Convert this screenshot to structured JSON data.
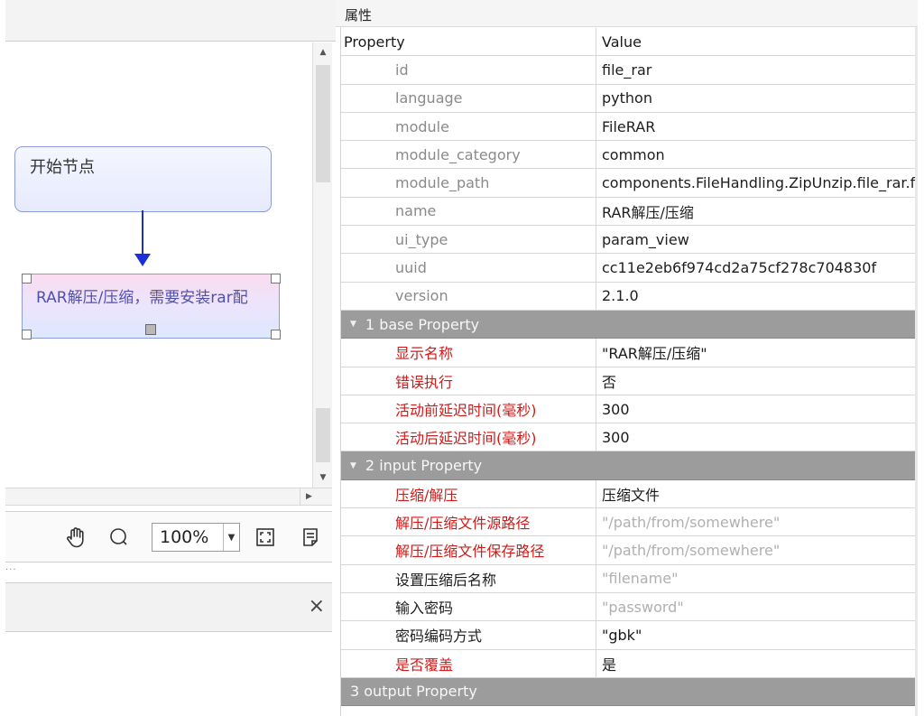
{
  "properties_panel": {
    "title": "属性",
    "header": {
      "property": "Property",
      "value": "Value"
    },
    "meta_rows": [
      {
        "key": "id",
        "value": "file_rar"
      },
      {
        "key": "language",
        "value": "python"
      },
      {
        "key": "module",
        "value": "FileRAR"
      },
      {
        "key": "module_category",
        "value": "common"
      },
      {
        "key": "module_path",
        "value": "components.FileHandling.ZipUnzip.file_rar.f"
      },
      {
        "key": "name",
        "value": "RAR解压/压缩"
      },
      {
        "key": "ui_type",
        "value": "param_view"
      },
      {
        "key": "uuid",
        "value": "cc11e2eb6f974cd2a75cf278c704830f"
      },
      {
        "key": "version",
        "value": "2.1.0"
      }
    ],
    "groups": [
      {
        "label": "1 base Property",
        "rows": [
          {
            "key": "显示名称",
            "value": "\"RAR解压/压缩\""
          },
          {
            "key": "错误执行",
            "value": "否"
          },
          {
            "key": "活动前延迟时间(毫秒)",
            "value": "300"
          },
          {
            "key": "活动后延迟时间(毫秒)",
            "value": "300"
          }
        ]
      },
      {
        "label": "2 input Property",
        "rows": [
          {
            "key": "压缩/解压",
            "value": "压缩文件"
          },
          {
            "key": "解压/压缩文件源路径",
            "value": "\"/path/from/somewhere\""
          },
          {
            "key": "解压/压缩文件保存路径",
            "value": "\"/path/from/somewhere\""
          },
          {
            "key": "设置压缩后名称",
            "value": "\"filename\""
          },
          {
            "key": "输入密码",
            "value": "\"password\""
          },
          {
            "key": "密码编码方式",
            "value": "\"gbk\""
          },
          {
            "key": "是否覆盖",
            "value": "是"
          }
        ]
      },
      {
        "label": "3 output Property",
        "rows": []
      }
    ]
  },
  "canvas": {
    "start_node_label": "开始节点",
    "rar_node_label": "RAR解压/压缩，需要安装rar配"
  },
  "zoombar": {
    "zoom_value": "100%",
    "icons": [
      "hand-pan-icon",
      "zoom-circle-icon",
      "fit-screen-icon",
      "document-icon"
    ]
  },
  "bottom_panel": {
    "close_glyph": "×"
  },
  "colors": {
    "required_label": "#d01a1a",
    "group_header_bg": "#9c9c9c",
    "connector": "#1a2fd6",
    "node_border": "#8d9bd8"
  }
}
